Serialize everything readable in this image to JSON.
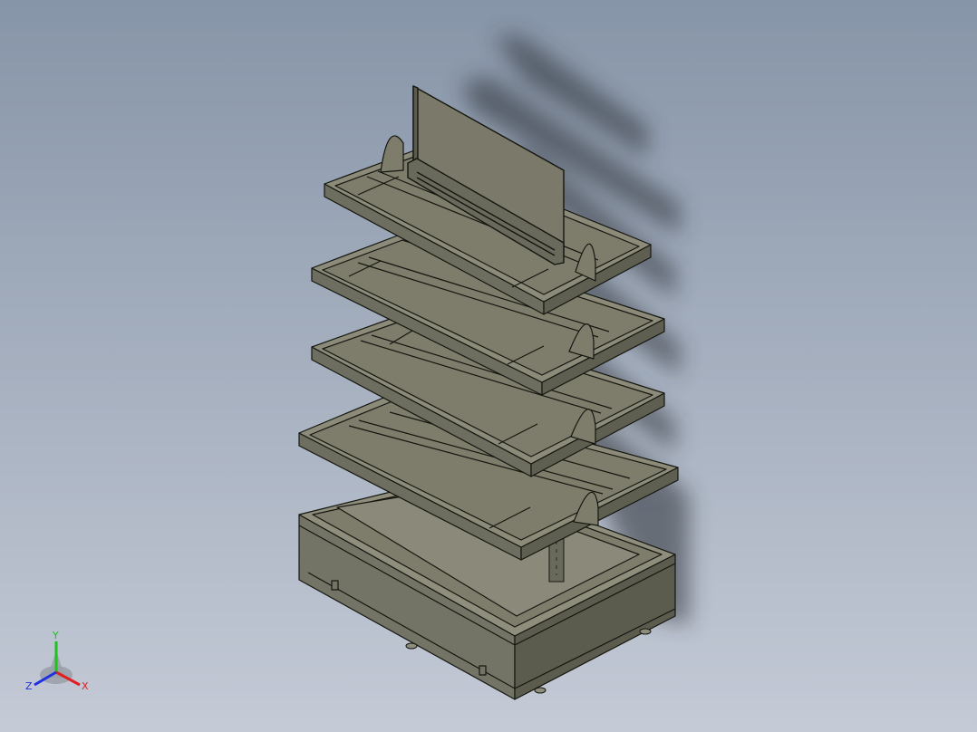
{
  "viewport": {
    "background_top": "#8795a8",
    "background_bottom": "#c4cad6",
    "model": "shelf-display-unit",
    "shelf_count": 4,
    "part_color": "#7e7d6c"
  },
  "triad": {
    "x_label": "X",
    "y_label": "Y",
    "z_label": "Z",
    "x_color": "#e02020",
    "y_color": "#20c020",
    "z_color": "#2030e0"
  }
}
